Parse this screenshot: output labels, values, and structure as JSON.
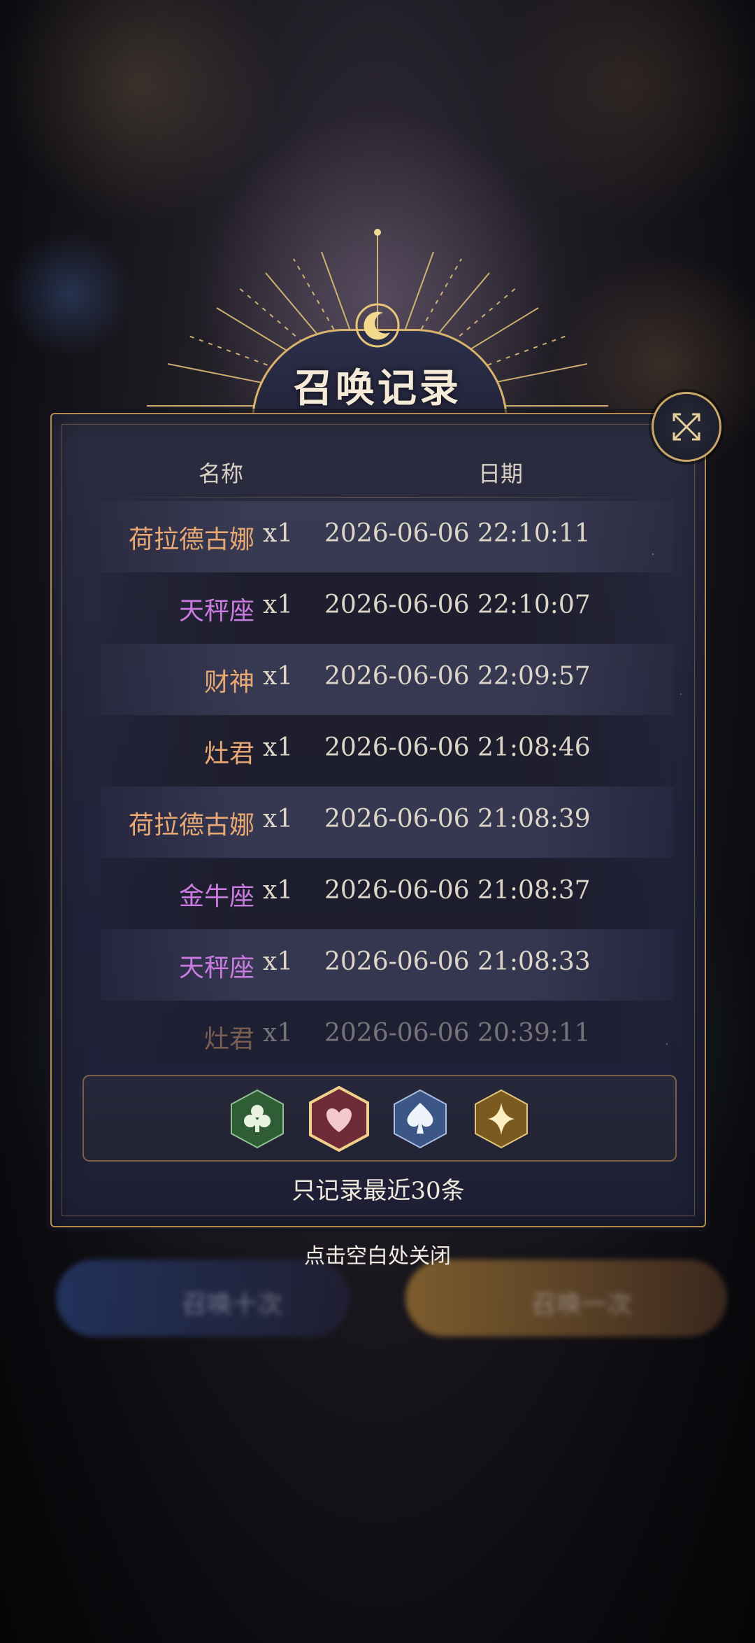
{
  "title": "召唤记录",
  "header": {
    "name_label": "名称",
    "date_label": "日期"
  },
  "records": [
    {
      "name": "荷拉德古娜",
      "qty": "x1",
      "date": "2026-06-06 22:10:11",
      "rarity": "orange"
    },
    {
      "name": "天秤座",
      "qty": "x1",
      "date": "2026-06-06 22:10:07",
      "rarity": "purple"
    },
    {
      "name": "财神",
      "qty": "x1",
      "date": "2026-06-06 22:09:57",
      "rarity": "orange"
    },
    {
      "name": "灶君",
      "qty": "x1",
      "date": "2026-06-06 21:08:46",
      "rarity": "orange"
    },
    {
      "name": "荷拉德古娜",
      "qty": "x1",
      "date": "2026-06-06 21:08:39",
      "rarity": "orange"
    },
    {
      "name": "金牛座",
      "qty": "x1",
      "date": "2026-06-06 21:08:37",
      "rarity": "purple"
    },
    {
      "name": "天秤座",
      "qty": "x1",
      "date": "2026-06-06 21:08:33",
      "rarity": "purple"
    },
    {
      "name": "灶君",
      "qty": "x1",
      "date": "2026-06-06 20:39:11",
      "rarity": "orange"
    }
  ],
  "filters": [
    {
      "name": "club-suit-icon",
      "color": "#3f8a4a",
      "selected": false
    },
    {
      "name": "heart-suit-icon",
      "color": "#c24a58",
      "selected": true
    },
    {
      "name": "spade-suit-icon",
      "color": "#4a6aa8",
      "selected": false
    },
    {
      "name": "star-sparkle-icon",
      "color": "#b8892f",
      "selected": false
    }
  ],
  "note": "只记录最近30条",
  "close_hint": "点击空白处关闭",
  "background": {
    "left_button": "召唤十次",
    "right_button": "召唤一次"
  },
  "colors": {
    "gold": "#d9b36c",
    "orange_rarity": "#e8a873",
    "purple_rarity": "#c97be0"
  }
}
